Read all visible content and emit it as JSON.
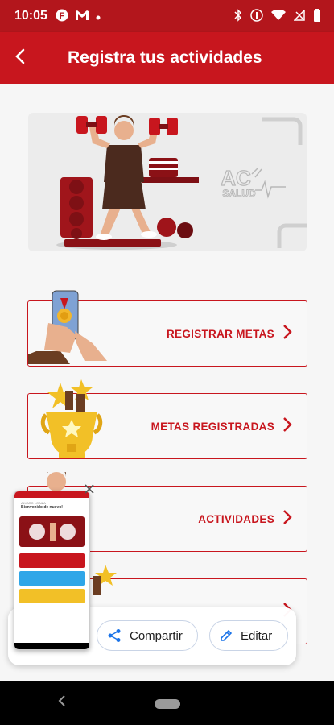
{
  "status_bar": {
    "time": "10:05",
    "left_icons": [
      "notification-f-icon",
      "gmail-icon",
      "dot-icon"
    ],
    "right_icons": [
      "bluetooth-icon",
      "vibrate-icon",
      "wifi-icon",
      "no-signal-icon",
      "battery-icon"
    ]
  },
  "app_bar": {
    "title": "Registra tus actividades",
    "background": "#c8161e"
  },
  "hero": {
    "logo_text": "AC",
    "logo_subtext": "SALUD"
  },
  "menu": {
    "items": [
      {
        "label": "REGISTRAR METAS",
        "icon": "phone-medal-icon"
      },
      {
        "label": "METAS REGISTRADAS",
        "icon": "trophy-icon"
      },
      {
        "label": "ACTIVIDADES",
        "icon": "person-icon"
      },
      {
        "label": "",
        "icon": "trophy-icon"
      }
    ],
    "accent": "#c8161e"
  },
  "preview": {
    "heading": "Bienvenido de nuevo!",
    "subheading": "ALVARO LOAIZA"
  },
  "share_bar": {
    "share_label": "Compartir",
    "edit_label": "Editar",
    "accent": "#1a73e8"
  },
  "nav_bar": {
    "back_icon": "nav-back-icon",
    "home_icon": "nav-home-pill"
  }
}
